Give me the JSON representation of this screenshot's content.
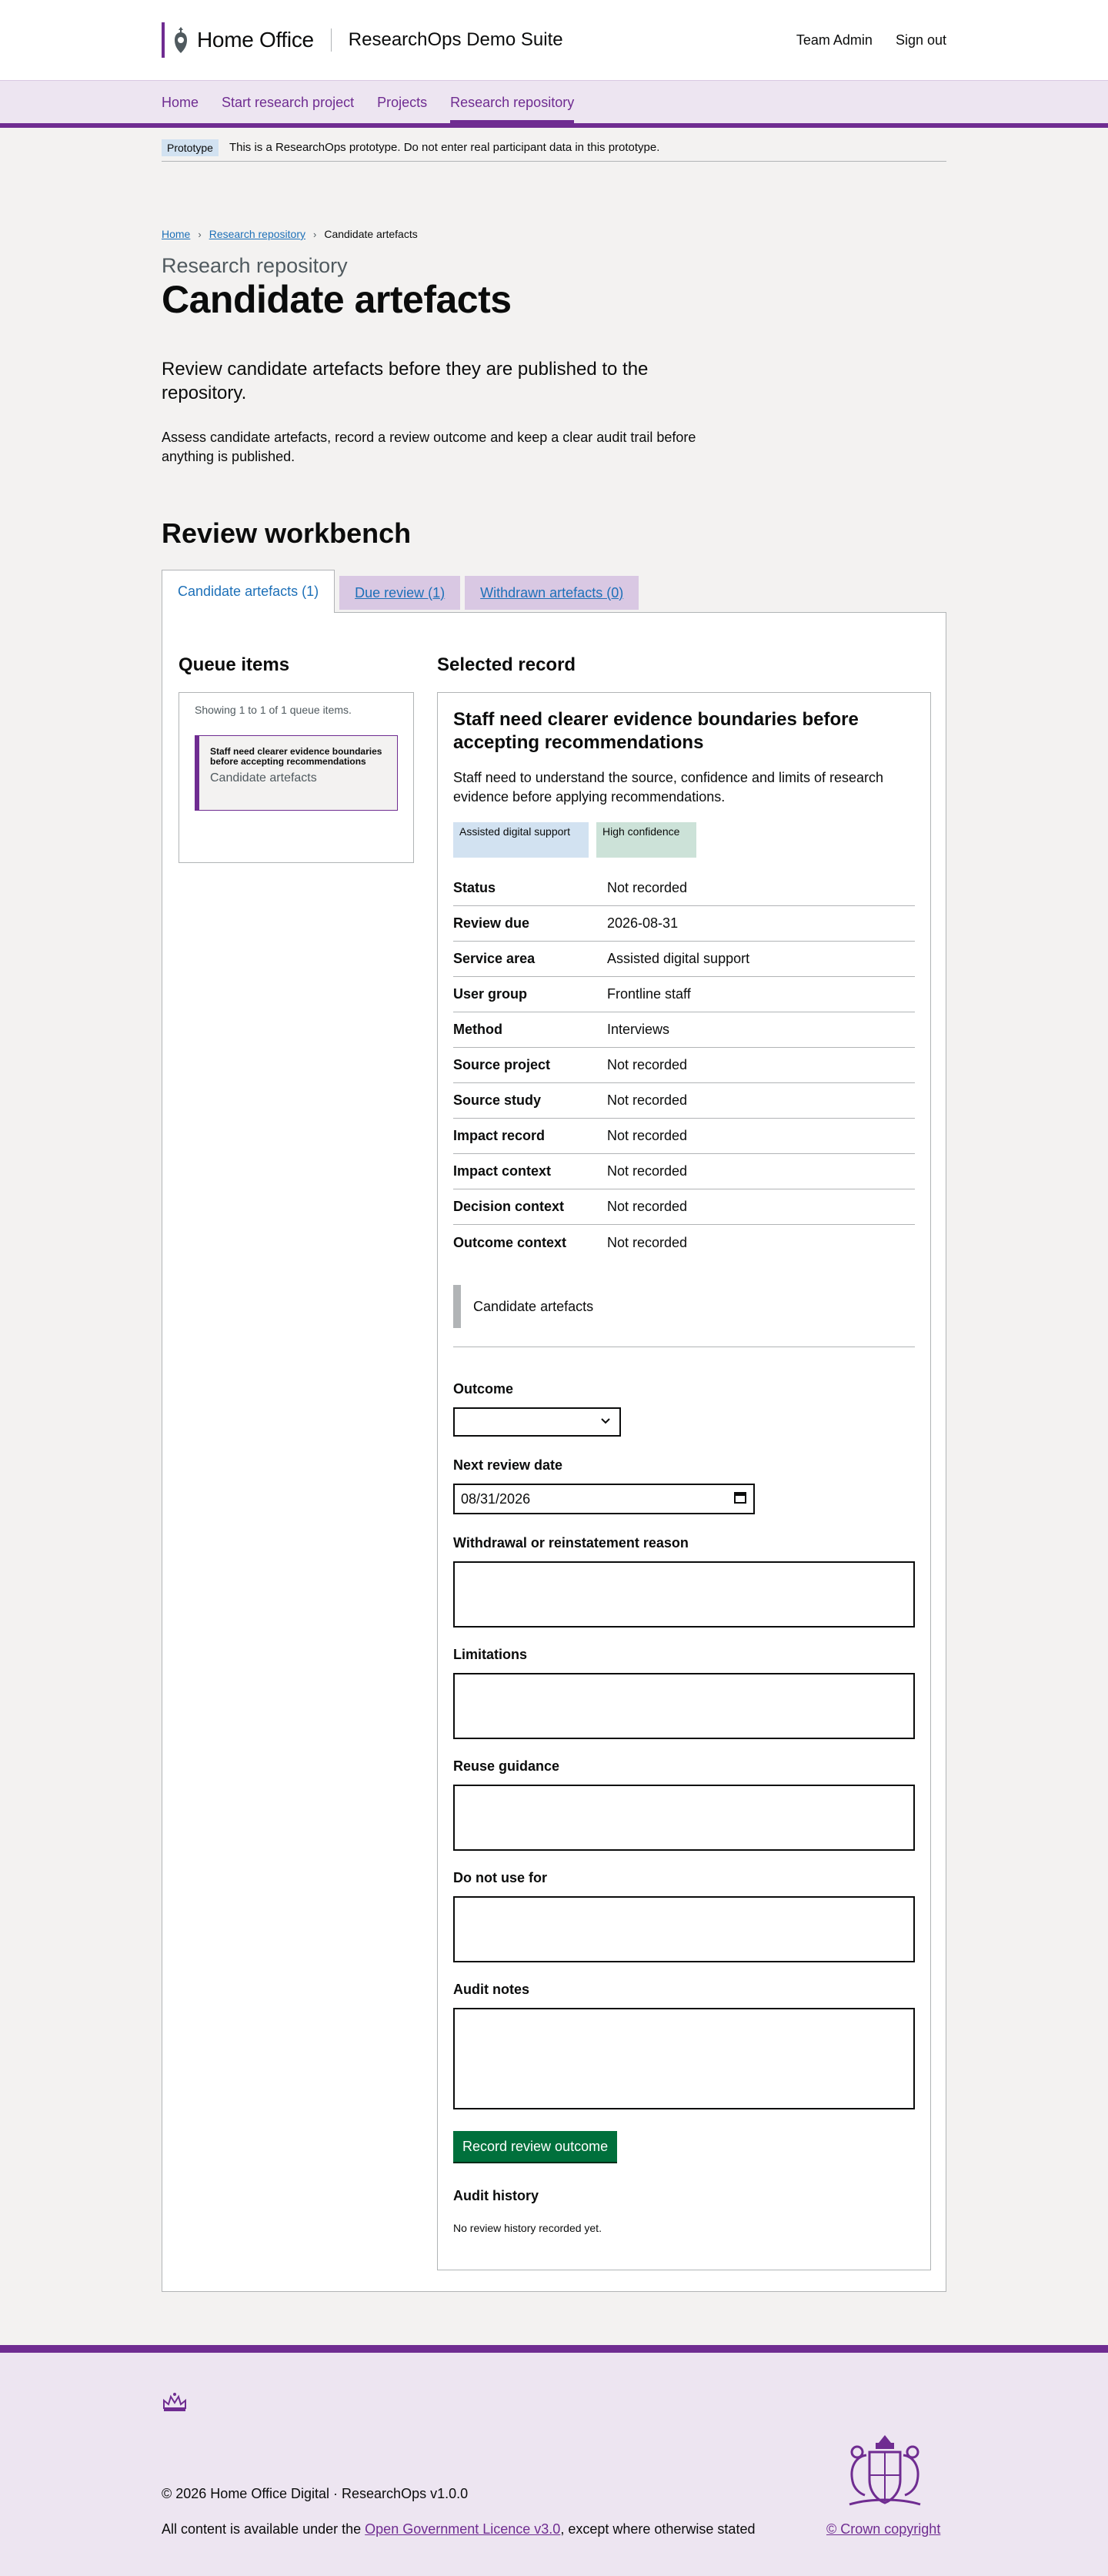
{
  "header": {
    "organisation": "Home Office",
    "suite": "ResearchOps Demo Suite",
    "links": [
      "Team Admin",
      "Sign out"
    ]
  },
  "nav": {
    "items": [
      "Home",
      "Start research project",
      "Projects",
      "Research repository"
    ],
    "active": "Research repository"
  },
  "prototype": {
    "tag": "Prototype",
    "text": "This is a ResearchOps prototype. Do not enter real participant data in this prototype."
  },
  "breadcrumb": [
    "Home",
    "Research repository",
    "Candidate artefacts"
  ],
  "page": {
    "caption": "Research repository",
    "title": "Candidate artefacts",
    "lead": "Review candidate artefacts before they are published to the repository.",
    "intro": "Assess candidate artefacts, record a review outcome and keep a clear audit trail before anything is published."
  },
  "workbench": {
    "title": "Review workbench",
    "tabs": [
      "Candidate artefacts (1)",
      "Due review (1)",
      "Withdrawn artefacts (0)"
    ]
  },
  "queue": {
    "heading": "Queue items",
    "count": "Showing 1 to 1 of 1 queue items.",
    "items": [
      {
        "title": "Staff need clearer evidence boundaries before accepting recommendations",
        "type": "Candidate artefacts"
      }
    ]
  },
  "record": {
    "heading": "Selected record",
    "title": "Staff need clearer evidence boundaries before accepting recommendations",
    "description": "Staff need to understand the source, confidence and limits of research evidence before applying recommendations.",
    "tags": [
      "Assisted digital support",
      "High confidence"
    ],
    "summary": [
      {
        "key": "Status",
        "value": "Not recorded"
      },
      {
        "key": "Review due",
        "value": "2026-08-31"
      },
      {
        "key": "Service area",
        "value": "Assisted digital support"
      },
      {
        "key": "User group",
        "value": "Frontline staff"
      },
      {
        "key": "Method",
        "value": "Interviews"
      },
      {
        "key": "Source project",
        "value": "Not recorded"
      },
      {
        "key": "Source study",
        "value": "Not recorded"
      },
      {
        "key": "Impact record",
        "value": "Not recorded"
      },
      {
        "key": "Impact context",
        "value": "Not recorded"
      },
      {
        "key": "Decision context",
        "value": "Not recorded"
      },
      {
        "key": "Outcome context",
        "value": "Not recorded"
      }
    ],
    "inset": "Candidate artefacts"
  },
  "form": {
    "outcome_label": "Outcome",
    "outcome_value": "",
    "next_review_label": "Next review date",
    "next_review_value": "08/31/2026",
    "withdrawal_label": "Withdrawal or reinstatement reason",
    "limitations_label": "Limitations",
    "reuse_label": "Reuse guidance",
    "do_not_use_label": "Do not use for",
    "audit_notes_label": "Audit notes",
    "submit": "Record review outcome",
    "audit_history_title": "Audit history",
    "audit_history_empty": "No review history recorded yet."
  },
  "footer": {
    "copyright": "© 2026 Home Office Digital · ResearchOps v1.0.0",
    "licence_prefix": "All content is available under the ",
    "licence_link": "Open Government Licence v3.0",
    "licence_suffix": ", except where otherwise stated",
    "crown_copyright": "© Crown copyright"
  },
  "colors": {
    "brand": "#6f2c91",
    "link": "#1d70b8",
    "button": "#00703c",
    "tag_blue": "#d2e2f1",
    "tag_green": "#cce2d8"
  }
}
